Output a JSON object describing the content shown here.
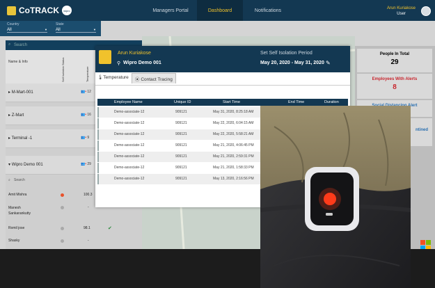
{
  "app": {
    "name": "CoTRACK",
    "badge": "wipro"
  },
  "nav": [
    {
      "label": "Managers Portal"
    },
    {
      "label": "Dashboard"
    },
    {
      "label": "Notifications"
    }
  ],
  "user": {
    "name": "Arun Kuriakose",
    "role": "User"
  },
  "filters": {
    "country_label": "Country",
    "country_value": "All",
    "state_label": "State",
    "state_value": "All"
  },
  "sidebar": {
    "search_placeholder": "Search",
    "header_name": "Name & Info",
    "header_col1": "Self Isolation Status",
    "header_col2": "Temperature",
    "groups": [
      {
        "label": "M-Mart-001",
        "count": "12"
      },
      {
        "label": "Z-Mart",
        "count": "16"
      },
      {
        "label": "Terminal -1",
        "count": "9"
      },
      {
        "label": "Wipro Demo 001",
        "count": "29"
      }
    ],
    "sub_search": "Search",
    "rows": [
      {
        "name": "Amit Mishra",
        "temp": "100.3"
      },
      {
        "name": "Manesh\nSankarankutty",
        "temp": "-"
      },
      {
        "name": "Romil jose",
        "temp": "98.1"
      },
      {
        "name": "Shasky",
        "temp": "-"
      }
    ]
  },
  "right_panel": {
    "people_title": "People In Total",
    "people_value": "29",
    "alerts_title": "Employees With Alerts",
    "alerts_value": "8",
    "social_title": "Social Distancing Alert",
    "fourth_title": "ntined"
  },
  "popup": {
    "name": "Arun Kuriakose",
    "group": "Wipro Demo 001",
    "period_label": "Set Self Isolation Period",
    "period_value": "May 20, 2020 - May 31, 2020",
    "tabs": [
      {
        "label": "Temperature"
      },
      {
        "label": "Contact Tracing"
      }
    ],
    "columns": [
      "Employee Name",
      "Unique ID",
      "Start Time",
      "End Time",
      "Duration"
    ],
    "rows": [
      {
        "name": "Demo-associate-12",
        "id": "909121",
        "start": "May 31, 2020, 8:25:18 AM"
      },
      {
        "name": "Demo-associate-12",
        "id": "909121",
        "start": "May 22, 2020, 6:04:15 AM"
      },
      {
        "name": "Demo-associate-12",
        "id": "909121",
        "start": "May 22, 2020, 5:58:21 AM"
      },
      {
        "name": "Demo-associate-12",
        "id": "909121",
        "start": "May 21, 2020, 4:06:45 PM"
      },
      {
        "name": "Demo-associate-12",
        "id": "909121",
        "start": "May 21, 2020, 2:59:31 PM"
      },
      {
        "name": "Demo-associate-12",
        "id": "909121",
        "start": "May 21, 2020, 1:58:33 PM"
      },
      {
        "name": "Demo-associate-12",
        "id": "909121",
        "start": "May 13, 2020, 2:16:56 PM"
      }
    ]
  },
  "colors": {
    "navy": "#133852",
    "gold": "#f0c22c",
    "alert_red": "#c8262e",
    "device_led": "#ff3b1a"
  }
}
